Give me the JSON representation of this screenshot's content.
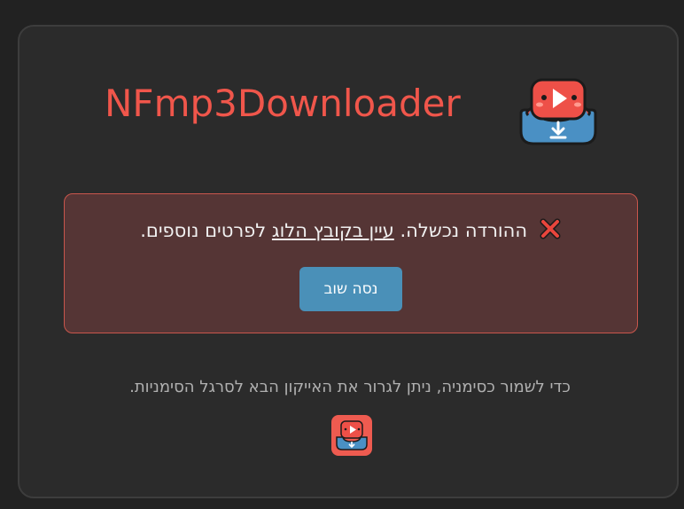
{
  "header": {
    "title": "NFmp3Downloader",
    "logo_icon": "app-logo-icon"
  },
  "error": {
    "icon": "close-x-icon",
    "message_before": "ההורדה נכשלה.",
    "log_link": "עיין בקובץ הלוג",
    "message_after": "לפרטים נוספים.",
    "retry_label": "נסה שוב",
    "colors": {
      "background": "#553535",
      "border": "#c9564c",
      "button": "#4a90b8"
    }
  },
  "bookmark": {
    "hint": "כדי לשמור כסימניה, ניתן לגרור את האייקון הבא לסרגל הסימניות.",
    "icon": "app-logo-icon"
  },
  "colors": {
    "accent": "#f0564b",
    "page_background": "#222222",
    "card_background": "#2b2b2b"
  }
}
